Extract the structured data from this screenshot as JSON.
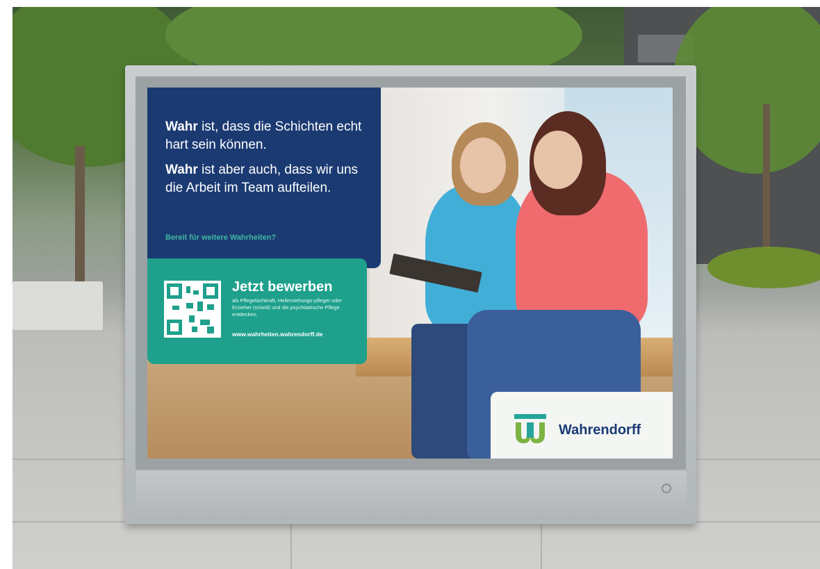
{
  "poster": {
    "headline_1_bold": "Wahr",
    "headline_1_rest": " ist, dass die Schichten echt hart sein können.",
    "headline_2_bold": "Wahr",
    "headline_2_rest": " ist aber auch, dass wir uns die Arbeit im Team aufteilen.",
    "tagline": "Bereit für weitere Wahrheiten?",
    "cta_title": "Jetzt bewerben",
    "cta_description": "als Pflegefachkraft, Heilerziehungs-pfleger oder Erzieher (m/w/d) und die psychiatrische Pflege entdecken.",
    "cta_url": "www.wahrheiten.wahrendorff.de",
    "logo_text": "Wahrendorff"
  },
  "colors": {
    "navy": "#1b3a72",
    "teal": "#1ea08c",
    "logo_green": "#7cb342",
    "logo_teal": "#26a69a"
  }
}
